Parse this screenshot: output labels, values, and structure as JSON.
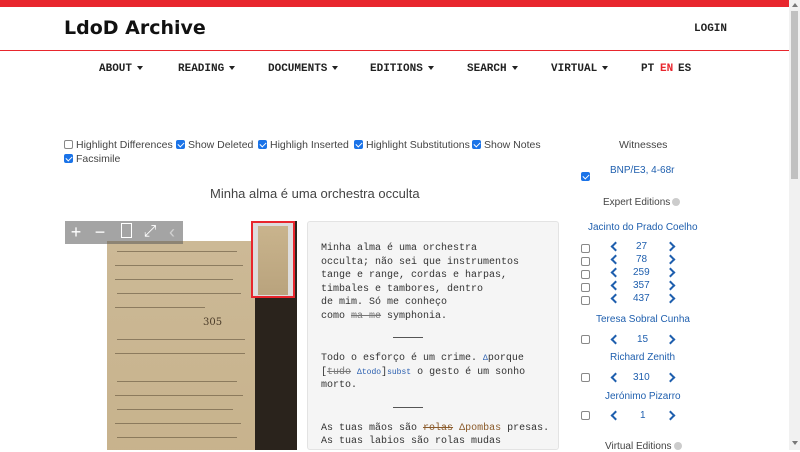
{
  "header": {
    "brand": "LdoD Archive",
    "login": "LOGIN"
  },
  "nav": {
    "items": [
      "ABOUT",
      "READING",
      "DOCUMENTS",
      "EDITIONS",
      "SEARCH",
      "VIRTUAL"
    ],
    "lang_pt": "PT",
    "lang_en": "EN",
    "lang_es": "ES"
  },
  "options": {
    "highlight_differences": "Highlight Differences",
    "show_deleted": "Show Deleted",
    "highlight_inserted": "Highligh Inserted",
    "highlight_substitutions": "Highlight Substitutions",
    "show_notes": "Show Notes",
    "facsimile": "Facsimile"
  },
  "fragment_title": "Minha alma é uma orchestra occulta",
  "viewer": {
    "page_number": "305"
  },
  "transcription": {
    "p1": [
      "Minha alma é uma orchestra",
      "occulta; não sei que instrumentos",
      "tange e range, cordas e harpas,",
      "timbales e tambores, dentro",
      "de mim. Só me conheço"
    ],
    "p1_last_a": "como ",
    "p1_last_del": "ma me",
    "p1_last_b": " symphonia.",
    "p2_a": "Todo o esforço é um crime. ",
    "p2_ins1": "Δ",
    "p2_b": "porque",
    "p2_c": "[",
    "p2_del": "tudo",
    "p2_d": " ",
    "p2_ins2": "Δtodo",
    "p2_e": "]",
    "p2_subst": "subst",
    "p2_f": " o gesto é um sonho",
    "p2_last": "morto.",
    "p3_a": "As tuas mãos são ",
    "p3_sub1": "rolas",
    "p3_b": " ",
    "p3_sub2": "Δpombas",
    "p3_c": " presas.",
    "p3_next": "As tuas labios são rolas mudas"
  },
  "sidebar": {
    "witnesses_title": "Witnesses",
    "witness": "BNP/E3, 4-68r",
    "expert_title": "Expert Editions",
    "editor1": "Jacinto do Prado Coelho",
    "editor1_nums": [
      "27",
      "78",
      "259",
      "357",
      "437"
    ],
    "editor2": "Teresa Sobral Cunha",
    "editor2_nums": [
      "15"
    ],
    "editor3": "Richard Zenith",
    "editor3_nums": [
      "310"
    ],
    "editor4": "Jerónimo Pizarro",
    "editor4_nums": [
      "1"
    ],
    "virtual_title": "Virtual Editions"
  },
  "colors": {
    "accent": "#e8262d",
    "link": "#1f5fae",
    "check": "#1a73e8"
  }
}
